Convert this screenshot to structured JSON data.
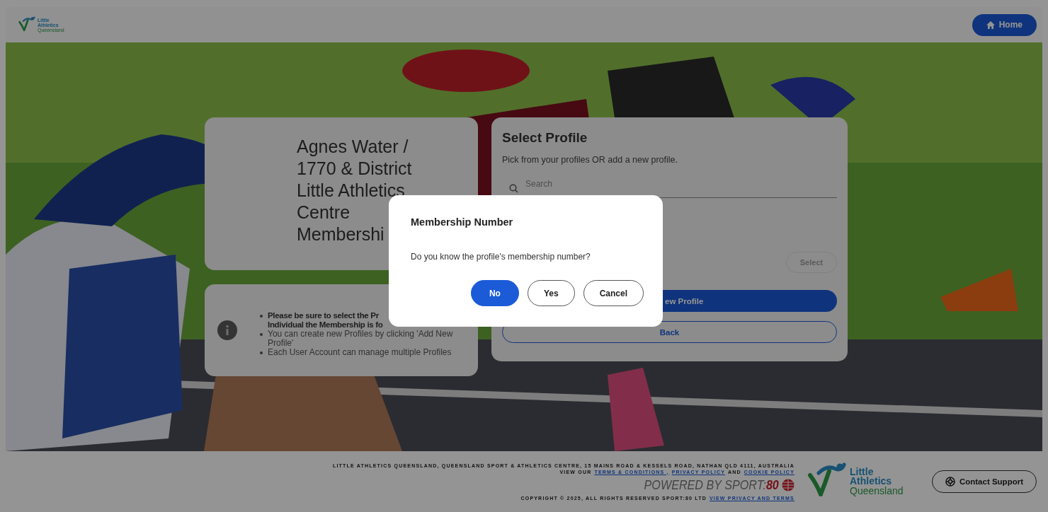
{
  "header": {
    "logo_text": [
      "Little",
      "Athletics",
      "Queensland"
    ],
    "home_button": "Home"
  },
  "centre_card": {
    "title_lines": [
      "Agnes Water /",
      "1770 & District",
      "Little Athletics",
      "Centre",
      "Membershi"
    ]
  },
  "info_card": {
    "bullets": [
      {
        "lines": [
          "Please be sure to select the Pr",
          "Individual the Membership is fo"
        ],
        "bold": true
      },
      {
        "lines": [
          "You can create new Profiles by clicking 'Add New Profile'"
        ],
        "bold": false
      },
      {
        "lines": [
          "Each User Account can manage multiple Profiles"
        ],
        "bold": false
      }
    ]
  },
  "profile_card": {
    "title": "Select Profile",
    "subtitle": "Pick from your profiles OR add a new profile.",
    "search": {
      "placeholder": "Search"
    },
    "select_button": {
      "label": "Select",
      "disabled": true
    },
    "add_button": "ew Profile",
    "back_button": "Back"
  },
  "dialog": {
    "title": "Membership Number",
    "message": "Do you know the profile's membership number?",
    "buttons": [
      {
        "label": "No",
        "primary": true
      },
      {
        "label": "Yes",
        "primary": false
      },
      {
        "label": "Cancel",
        "primary": false
      }
    ]
  },
  "footer": {
    "address": "LITTLE ATHLETICS QUEENSLAND, QUEENSLAND SPORT & ATHLETICS CENTRE, 15 MAINS ROAD & KESSELS ROAD, NATHAN QLD 4111, AUSTRALIA",
    "view_our": "VIEW OUR",
    "links": [
      "TERMS & CONDITIONS ,",
      "PRIVACY POLICY"
    ],
    "and": "AND",
    "cookie_link": "COOKIE POLICY",
    "powered_by": "POWERED BY SPORT:",
    "powered_num": "80",
    "copyright": "COPYRIGHT © 2025, ALL RIGHTS RESERVED SPORT:80 LTD",
    "copyright_link": "VIEW PRIVACY AND TERMS",
    "logo_text": [
      "Little",
      "Athletics",
      "Queensland"
    ],
    "support_button": "Contact Support"
  }
}
